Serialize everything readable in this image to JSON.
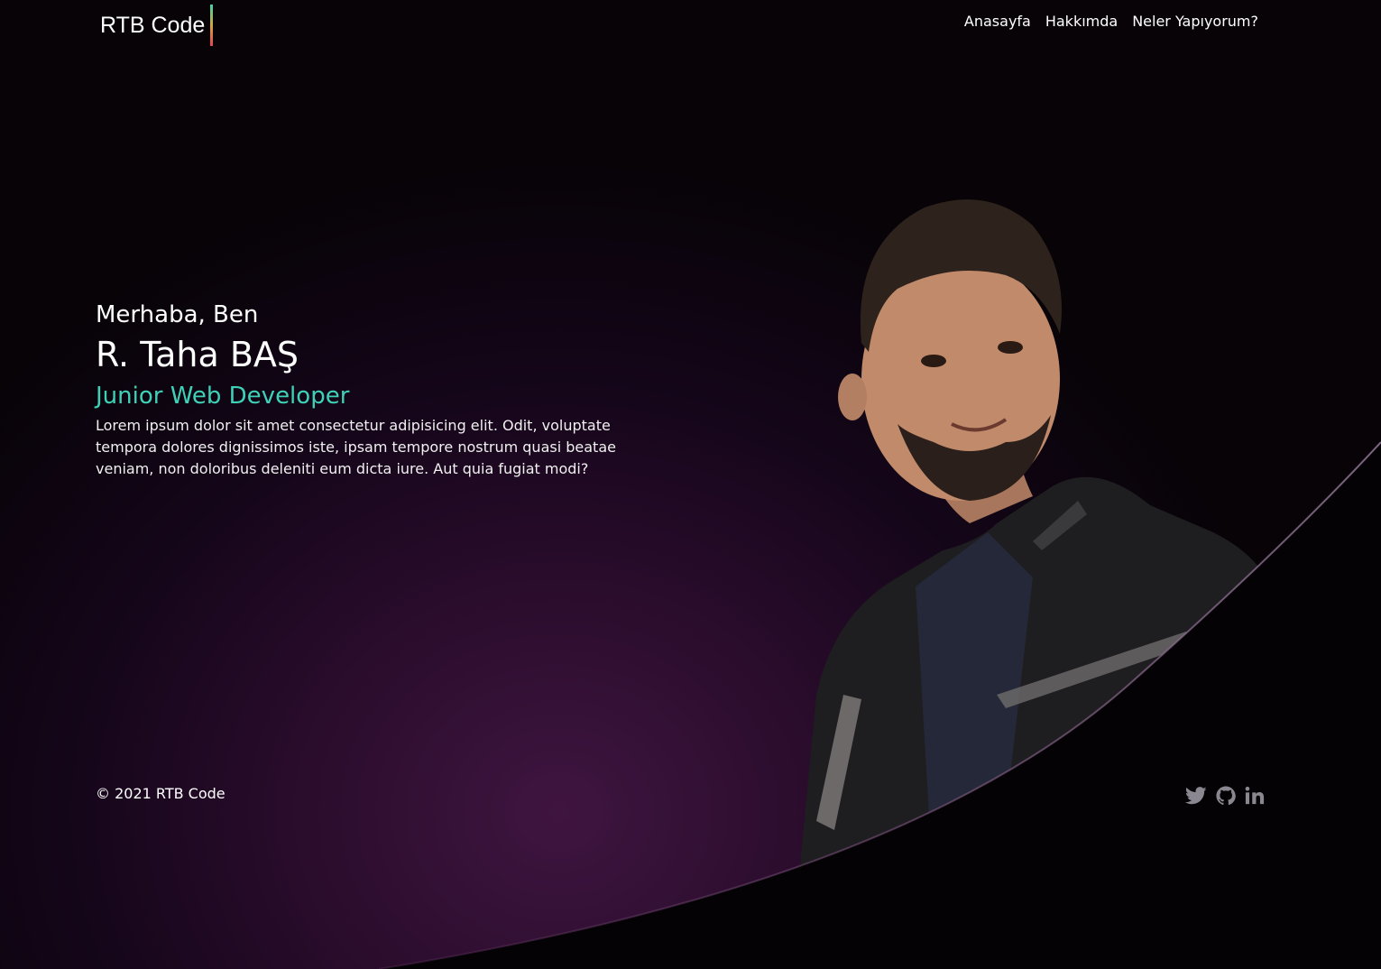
{
  "brand": {
    "name": "RTB Code"
  },
  "nav": {
    "home": "Anasayfa",
    "about": "Hakkımda",
    "services": "Neler Yapıyorum?"
  },
  "hero": {
    "greeting": "Merhaba, Ben",
    "name": "R. Taha BAŞ",
    "role": "Junior Web Developer",
    "description": "Lorem ipsum dolor sit amet consectetur adipisicing elit. Odit, voluptate tempora dolores dignissimos iste, ipsam tempore nostrum quasi beatae veniam, non doloribus deleniti eum dicta iure. Aut quia fugiat modi?"
  },
  "footer": {
    "copyright": "© 2021 RTB Code"
  },
  "social": {
    "icons": [
      "twitter-icon",
      "github-icon",
      "linkedin-icon"
    ]
  },
  "colors": {
    "accent": "#3fd1b7",
    "background": "#070307",
    "glow": "#3f1540"
  }
}
